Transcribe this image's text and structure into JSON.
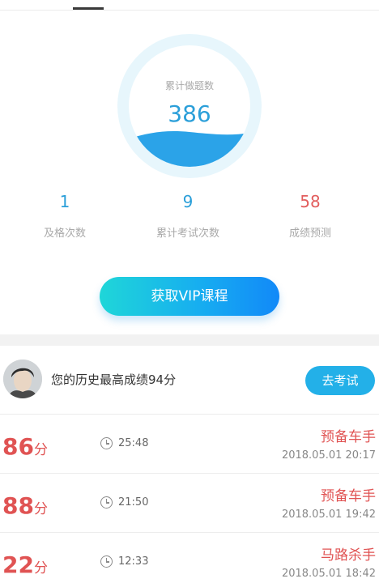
{
  "stats": {
    "gauge_label": "累计做题数",
    "gauge_value": "386",
    "pass_count": "1",
    "pass_label": "及格次数",
    "exam_count": "9",
    "exam_label": "累计考试次数",
    "prediction": "58",
    "prediction_label": "成绩预测"
  },
  "vip_button": "获取VIP课程",
  "profile": {
    "best_text": "您的历史最高成绩94分",
    "exam_button": "去考试"
  },
  "records": [
    {
      "score": "86",
      "unit": "分",
      "duration": "25:48",
      "title": "预备车手",
      "date": "2018.05.01  20:17"
    },
    {
      "score": "88",
      "unit": "分",
      "duration": "21:50",
      "title": "预备车手",
      "date": "2018.05.01  19:42"
    },
    {
      "score": "22",
      "unit": "分",
      "duration": "12:33",
      "title": "马路杀手",
      "date": "2018.05.01  18:42"
    }
  ],
  "colors": {
    "accent_blue": "#2b9fd9",
    "score_red": "#e05353",
    "button_blue": "#23b0e8"
  }
}
